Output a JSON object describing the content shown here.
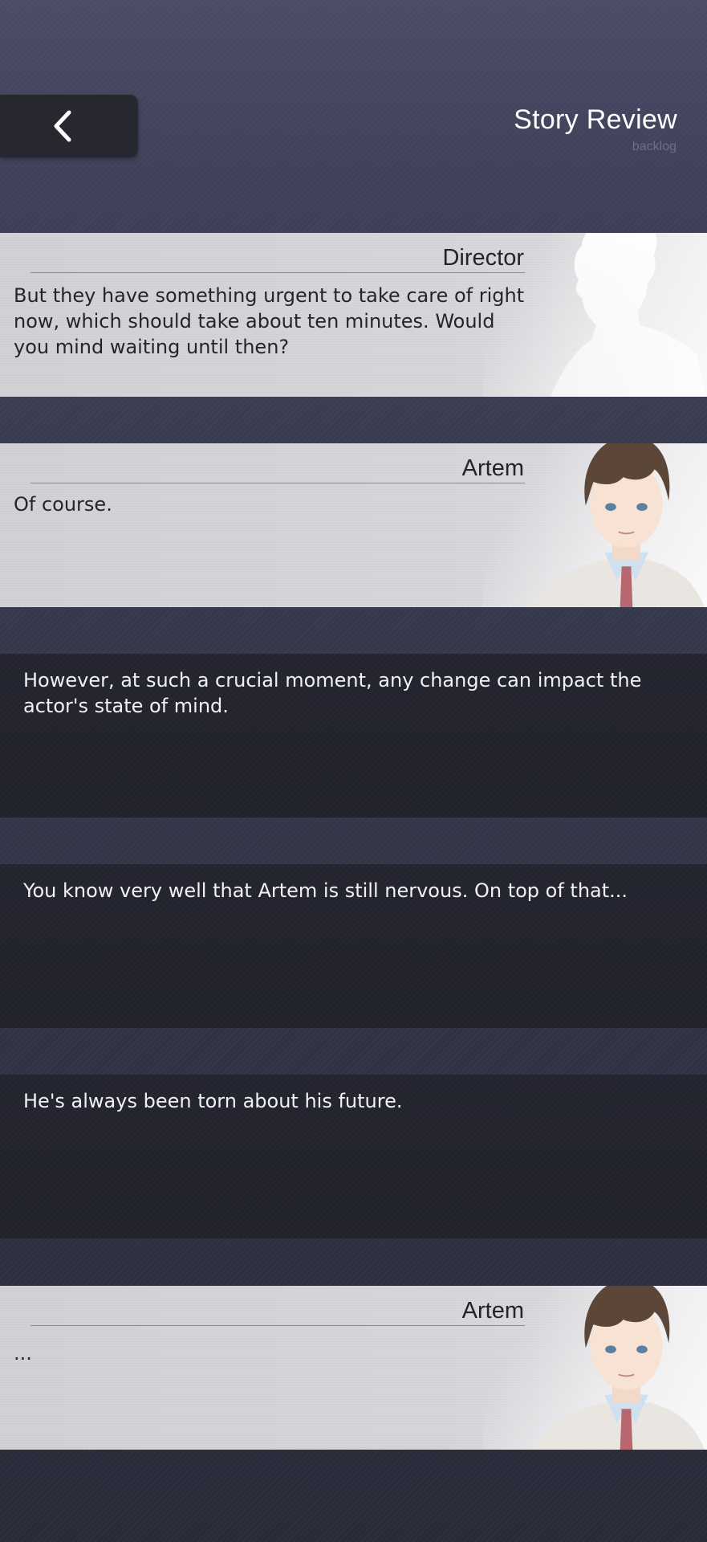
{
  "header": {
    "back_icon": "chevron-left-icon",
    "title": "Story Review",
    "subtitle": "backlog"
  },
  "entries": [
    {
      "type": "dialogue",
      "speaker": "Director",
      "text": "But they have something urgent to take care of right now, which should take about ten minutes. Would you mind waiting until then?",
      "portrait": "silhouette-portrait"
    },
    {
      "type": "dialogue",
      "speaker": "Artem",
      "text": "Of course.",
      "portrait": "artem-portrait"
    },
    {
      "type": "narration",
      "text": "However, at such a crucial moment, any change can impact the actor's state of mind."
    },
    {
      "type": "narration",
      "text": "You know very well that Artem is still nervous. On top of that..."
    },
    {
      "type": "narration",
      "text": "He's always been torn about his future."
    },
    {
      "type": "dialogue",
      "speaker": "Artem",
      "text": "...",
      "portrait": "artem-portrait"
    }
  ],
  "colors": {
    "background": "#35374b",
    "light_row": "#d6d6da",
    "dark_row": "#22232d",
    "text_dark": "#24252c",
    "text_light": "#f1f1f4"
  }
}
